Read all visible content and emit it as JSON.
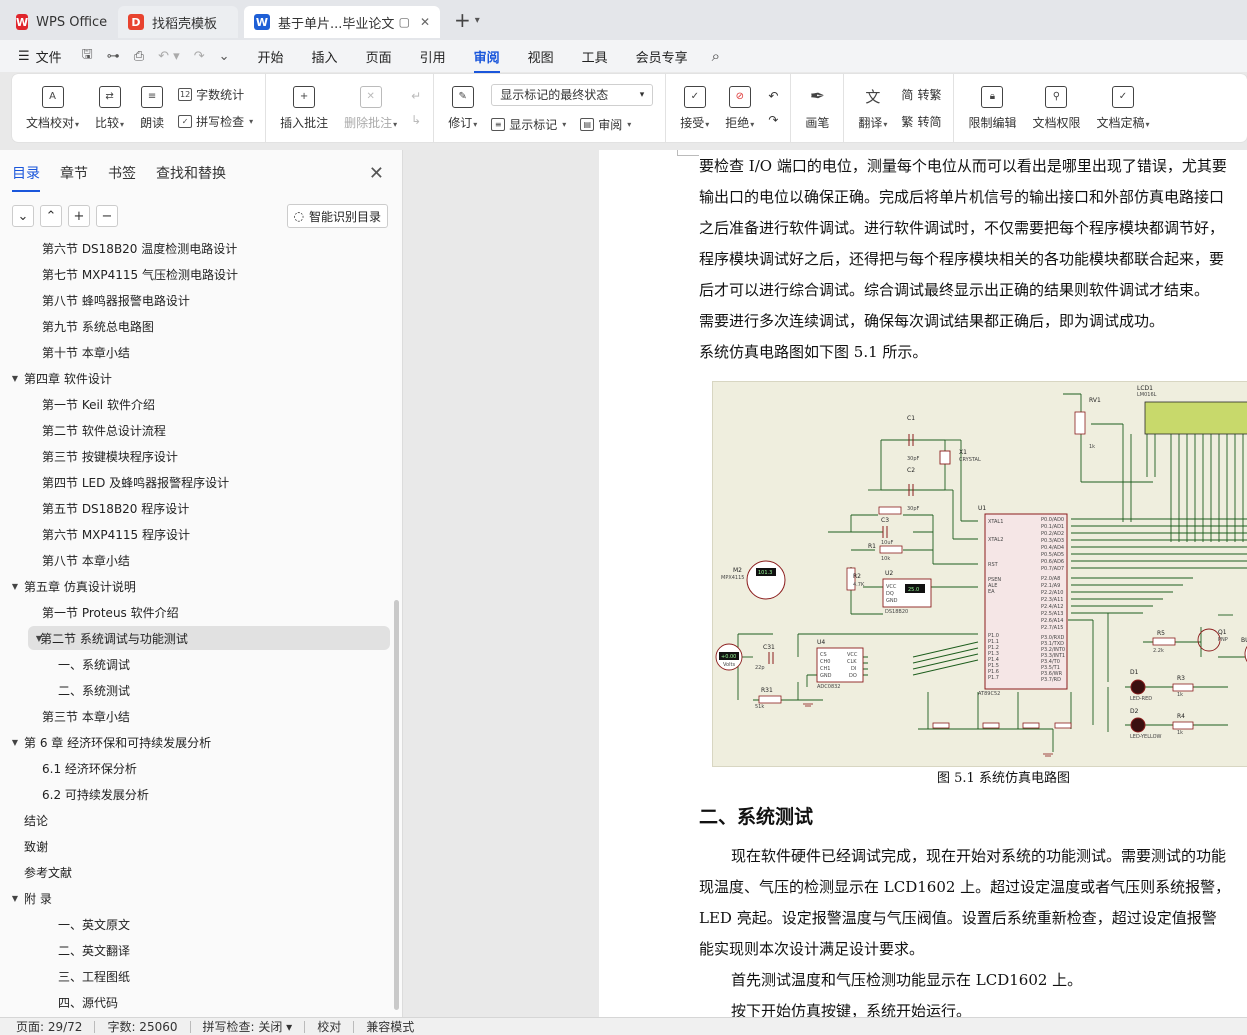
{
  "tabs": [
    {
      "label": "WPS Office",
      "icon": "wps-icon"
    },
    {
      "label": "找稻壳模板",
      "icon": "docer-icon"
    },
    {
      "label": "基于单片...毕业论文",
      "icon": "word-doc-icon"
    }
  ],
  "menu": {
    "file_label": "文件",
    "items": [
      "开始",
      "插入",
      "页面",
      "引用",
      "审阅",
      "视图",
      "工具",
      "会员专享"
    ],
    "active": "审阅"
  },
  "ribbon": {
    "doc_proof": "文档校对",
    "compare": "比较",
    "read_aloud": "朗读",
    "word_count": "字数统计",
    "spell_check": "拼写检查",
    "insert_comment": "插入批注",
    "delete_comment": "删除批注",
    "track_changes": "修订",
    "markup_select": "显示标记的最终状态",
    "show_markup": "显示标记",
    "review_pane": "审阅",
    "accept": "接受",
    "reject": "拒绝",
    "pen": "画笔",
    "translate": "翻译",
    "to_traditional": "转繁",
    "to_simplified": "转简",
    "restrict_editing": "限制编辑",
    "doc_permission": "文档权限",
    "doc_finalize": "文档定稿"
  },
  "nav": {
    "tabs": [
      "目录",
      "章节",
      "书签",
      "查找和替换"
    ],
    "smart_toc": "智能识别目录",
    "toc": [
      {
        "label": "第六节    DS18B20 温度检测电路设计",
        "level": 2,
        "arrow": ""
      },
      {
        "label": "第七节    MXP4115 气压检测电路设计",
        "level": 2,
        "arrow": ""
      },
      {
        "label": "第八节    蜂鸣器报警电路设计",
        "level": 2,
        "arrow": ""
      },
      {
        "label": "第九节    系统总电路图",
        "level": 2,
        "arrow": ""
      },
      {
        "label": "第十节    本章小结",
        "level": 2,
        "arrow": ""
      },
      {
        "label": "第四章    软件设计",
        "level": 1,
        "arrow": "▼"
      },
      {
        "label": "第一节    Keil 软件介绍",
        "level": 2,
        "arrow": ""
      },
      {
        "label": "第二节    软件总设计流程",
        "level": 2,
        "arrow": ""
      },
      {
        "label": "第三节    按键模块程序设计",
        "level": 2,
        "arrow": ""
      },
      {
        "label": "第四节    LED 及蜂鸣器报警程序设计",
        "level": 2,
        "arrow": ""
      },
      {
        "label": "第五节    DS18B20 程序设计",
        "level": 2,
        "arrow": ""
      },
      {
        "label": "第六节    MXP4115 程序设计",
        "level": 2,
        "arrow": ""
      },
      {
        "label": "第八节    本章小结",
        "level": 2,
        "arrow": ""
      },
      {
        "label": "第五章    仿真设计说明",
        "level": 1,
        "arrow": "▼"
      },
      {
        "label": "第一节    Proteus 软件介绍",
        "level": 2,
        "arrow": ""
      },
      {
        "label": "第二节    系统调试与功能测试",
        "level": 2,
        "arrow": "▼",
        "selected": true
      },
      {
        "label": "一、系统调试",
        "level": 3,
        "arrow": ""
      },
      {
        "label": "二、系统测试",
        "level": 3,
        "arrow": ""
      },
      {
        "label": "第三节    本章小结",
        "level": 2,
        "arrow": ""
      },
      {
        "label": "第 6 章  经济环保和可持续发展分析",
        "level": 1,
        "arrow": "▼"
      },
      {
        "label": "6.1 经济环保分析",
        "level": 2,
        "arrow": ""
      },
      {
        "label": "6.2 可持续发展分析",
        "level": 2,
        "arrow": ""
      },
      {
        "label": "结论",
        "level": 1,
        "arrow": ""
      },
      {
        "label": "致谢",
        "level": 1,
        "arrow": ""
      },
      {
        "label": "参考文献",
        "level": 1,
        "arrow": ""
      },
      {
        "label": "附    录",
        "level": 1,
        "arrow": "▼"
      },
      {
        "label": "一、英文原文",
        "level": 3,
        "arrow": ""
      },
      {
        "label": "二、英文翻译",
        "level": 3,
        "arrow": ""
      },
      {
        "label": "三、工程图纸",
        "level": 3,
        "arrow": ""
      },
      {
        "label": "四、源代码",
        "level": 3,
        "arrow": ""
      }
    ]
  },
  "document": {
    "paragraphs": [
      "要检查 I/O 端口的电位，测量每个电位从而可以看出是哪里出现了错误，尤其要",
      "输出口的电位以确保正确。完成后将单片机信号的输出接口和外部仿真电路接口",
      "之后准备进行软件调试。进行软件调试时，不仅需要把每个程序模块都调节好，",
      "程序模块调试好之后，还得把与每个程序模块相关的各功能模块都联合起来，要",
      "后才可以进行综合调试。综合调试最终显示出正确的结果则软件调试才结束。",
      "需要进行多次连续调试，确保每次调试结果都正确后，即为调试成功。",
      "系统仿真电路图如下图 5.1 所示。"
    ],
    "figure_caption": "图 5.1  系统仿真电路图",
    "heading": "二、系统测试",
    "paragraphs2": [
      "现在软件硬件已经调试完成，现在开始对系统的功能测试。需要测试的功能",
      "现温度、气压的检测显示在 LCD1602 上。超过设定温度或者气压则系统报警，",
      "LED 亮起。设定报警温度与气压阀值。设置后系统重新检查，超过设定值报警",
      "能实现则本次设计满足设计要求。",
      "首先测试温度和气压检测功能显示在 LCD1602 上。",
      "按下开始仿真按键，系统开始运行。"
    ],
    "circuit_labels": {
      "lcd": "LCD1",
      "lcd_model": "LM016L",
      "rv1": "RV1",
      "c1": "C1",
      "c1_val": "30pF",
      "c2": "C2",
      "c2_val": "30pF",
      "x1": "X1",
      "crystal": "CRYSTAL",
      "c3": "C3",
      "c3_val": "10uF",
      "r1": "R1",
      "r1_val": "10k",
      "r2": "R2",
      "r2_val": "4.7K",
      "u1": "U1",
      "u1_model": "AT89C52",
      "u2": "U2",
      "u2_model": "DS18B20",
      "u4": "U4",
      "u4_model": "ADC0832",
      "m2": "M2",
      "m2_model": "MPX4115",
      "c31": "C31",
      "c31_val": "22p",
      "r31": "R31",
      "r31_val": "51k",
      "r5": "R5",
      "r5_val": "2.2k",
      "q1": "Q1",
      "q1_model": "PNP",
      "d1": "D1",
      "d1_model": "LED-RED",
      "d2": "D2",
      "d2_model": "LED-YELLOW",
      "r3": "R3",
      "r3_val": "1k",
      "r4": "R4",
      "r4_val": "1k",
      "text_tag": "<TEXT>",
      "rv1_val": "1k",
      "bu": "BU",
      "u1_pins_left": [
        "XTAL1",
        "XTAL2",
        "RST",
        "PSEN",
        "ALE",
        "EA",
        "P1.0",
        "P1.1",
        "P1.2",
        "P1.3",
        "P1.4",
        "P1.5",
        "P1.6",
        "P1.7"
      ],
      "u1_pins_right": [
        "P0.0/AD0",
        "P0.1/AD1",
        "P0.2/AD2",
        "P0.3/AD3",
        "P0.4/AD4",
        "P0.5/AD5",
        "P0.6/AD6",
        "P0.7/AD7",
        "P2.0/A8",
        "P2.1/A9",
        "P2.2/A10",
        "P2.3/A11",
        "P2.4/A12",
        "P2.5/A13",
        "P2.6/A14",
        "P2.7/A15",
        "P3.0/RXD",
        "P3.1/TXD",
        "P3.2/INT0",
        "P3.3/INT1",
        "P3.4/T0",
        "P3.5/T1",
        "P3.6/WR",
        "P3.7/RD"
      ],
      "u2_pins": [
        "VCC",
        "DQ",
        "GND"
      ],
      "u4_pins_left": [
        "CS",
        "CH0",
        "CH1",
        "GND"
      ],
      "u4_pins_right": [
        "VCC",
        "CLK",
        "DI",
        "DO"
      ],
      "u2_display": "25.0",
      "m2_display": "101.3",
      "volts_display": "+0.00",
      "volts_unit": "Volts"
    }
  },
  "status": {
    "page": "页面: 29/72",
    "words": "字数: 25060",
    "spell": "拼写检查: 关闭",
    "proof": "校对",
    "compat": "兼容模式"
  }
}
